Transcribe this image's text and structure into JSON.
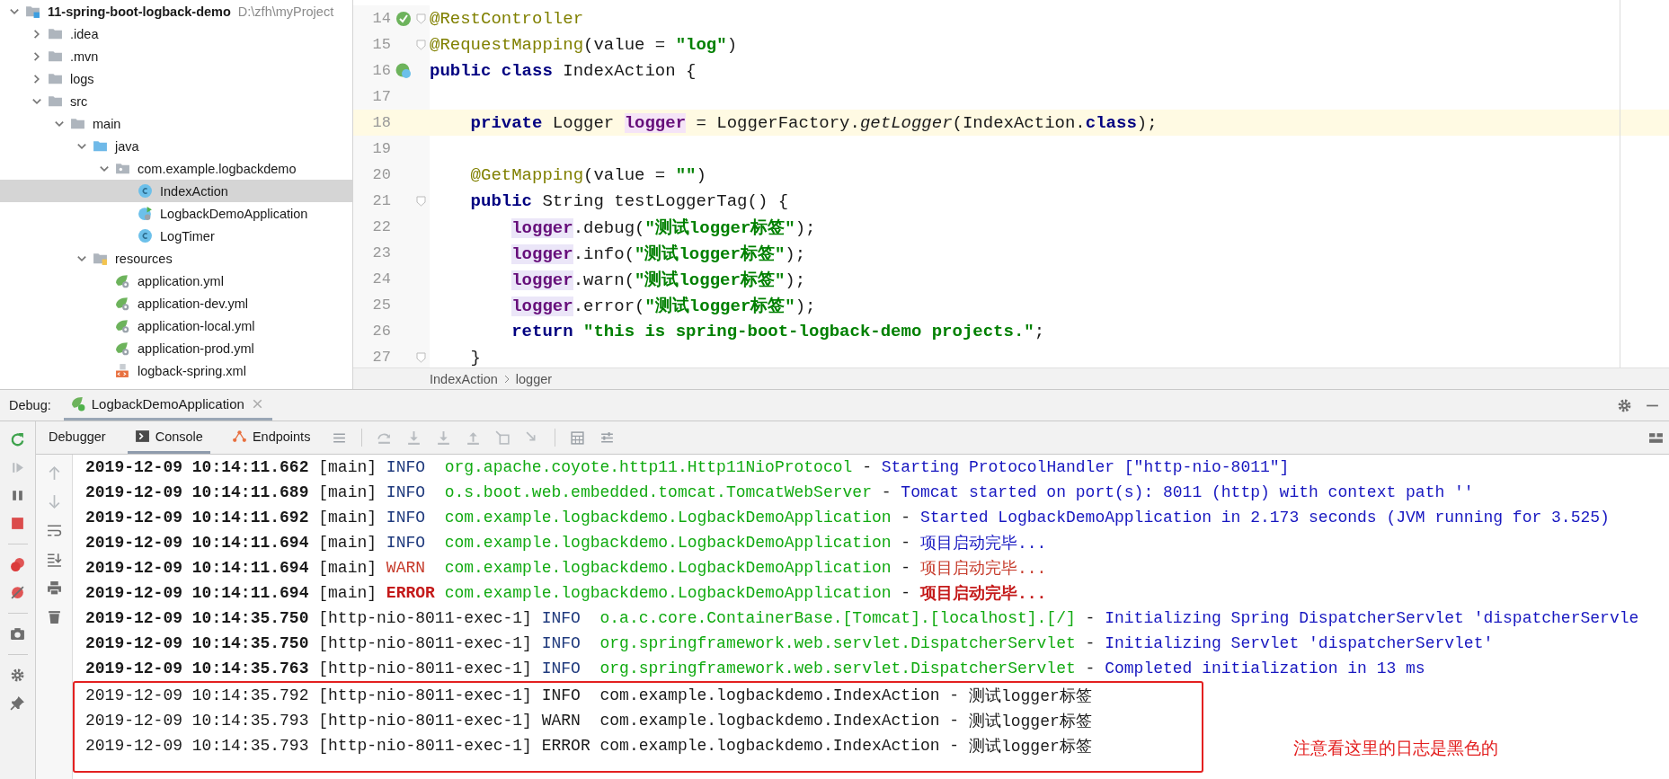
{
  "project_tree": [
    {
      "label": "11-spring-boot-logback-demo",
      "path": "D:\\zfh\\myProject",
      "kind": "module",
      "expanded": true,
      "selected": false,
      "children": [
        {
          "label": ".idea",
          "kind": "folder",
          "expanded": false,
          "selected": false
        },
        {
          "label": ".mvn",
          "kind": "folder",
          "expanded": false,
          "selected": false
        },
        {
          "label": "logs",
          "kind": "folder",
          "expanded": false,
          "selected": false
        },
        {
          "label": "src",
          "kind": "folder",
          "expanded": true,
          "selected": false,
          "children": [
            {
              "label": "main",
              "kind": "folder",
              "expanded": true,
              "selected": false,
              "children": [
                {
                  "label": "java",
                  "kind": "source-folder",
                  "expanded": true,
                  "selected": false,
                  "children": [
                    {
                      "label": "com.example.logbackdemo",
                      "kind": "package",
                      "expanded": true,
                      "selected": false,
                      "children": [
                        {
                          "label": "IndexAction",
                          "kind": "class",
                          "selected": true
                        },
                        {
                          "label": "LogbackDemoApplication",
                          "kind": "spring-class",
                          "selected": false
                        },
                        {
                          "label": "LogTimer",
                          "kind": "class",
                          "selected": false
                        }
                      ]
                    }
                  ]
                },
                {
                  "label": "resources",
                  "kind": "resources",
                  "expanded": true,
                  "selected": false,
                  "children": [
                    {
                      "label": "application.yml",
                      "kind": "spring-yml",
                      "selected": false
                    },
                    {
                      "label": "application-dev.yml",
                      "kind": "spring-yml",
                      "selected": false
                    },
                    {
                      "label": "application-local.yml",
                      "kind": "spring-yml",
                      "selected": false
                    },
                    {
                      "label": "application-prod.yml",
                      "kind": "spring-yml",
                      "selected": false
                    },
                    {
                      "label": "logback-spring.xml",
                      "kind": "xml",
                      "selected": false
                    }
                  ]
                }
              ]
            }
          ]
        }
      ]
    }
  ],
  "editor": {
    "lines": [
      {
        "number": "14",
        "kind": "bean",
        "fold": true,
        "current": false,
        "tokens": [
          {
            "text": "@RestController",
            "kind": "annotation"
          }
        ]
      },
      {
        "number": "15",
        "fold": true,
        "current": false,
        "tokens": [
          {
            "text": "@RequestMapping",
            "kind": "annotation"
          },
          {
            "text": "(value = ",
            "kind": "plain"
          },
          {
            "text": "\"log\"",
            "kind": "string"
          },
          {
            "text": ")",
            "kind": "plain"
          }
        ]
      },
      {
        "number": "16",
        "kind": "spring-class",
        "fold": false,
        "current": false,
        "tokens": [
          {
            "text": "public class ",
            "kind": "keyword"
          },
          {
            "text": "IndexAction {",
            "kind": "plain"
          }
        ]
      },
      {
        "number": "17",
        "fold": false,
        "current": false
      },
      {
        "number": "18",
        "fold": false,
        "current": true,
        "tokens": [
          {
            "text": "    private ",
            "kind": "keyword"
          },
          {
            "text": "Logger ",
            "kind": "plain"
          },
          {
            "text": "logger",
            "kind": "field-decl"
          },
          {
            "text": " = LoggerFactory.",
            "kind": "plain"
          },
          {
            "text": "getLogger",
            "kind": "static-call"
          },
          {
            "text": "(IndexAction.",
            "kind": "plain"
          },
          {
            "text": "class",
            "kind": "keyword"
          },
          {
            "text": ");",
            "kind": "plain"
          }
        ]
      },
      {
        "number": "19",
        "fold": false,
        "current": false
      },
      {
        "number": "20",
        "fold": false,
        "current": false,
        "tokens": [
          {
            "text": "    @GetMapping",
            "kind": "annotation"
          },
          {
            "text": "(value = ",
            "kind": "plain"
          },
          {
            "text": "\"\"",
            "kind": "string"
          },
          {
            "text": ")",
            "kind": "plain"
          }
        ]
      },
      {
        "number": "21",
        "fold": true,
        "current": false,
        "tokens": [
          {
            "text": "    public ",
            "kind": "keyword"
          },
          {
            "text": "String testLoggerTag() {",
            "kind": "plain"
          }
        ]
      },
      {
        "number": "22",
        "fold": false,
        "current": false,
        "tokens": [
          {
            "text": "        logger",
            "kind": "field"
          },
          {
            "text": ".debug(",
            "kind": "plain"
          },
          {
            "text": "\"测试logger标签\"",
            "kind": "string"
          },
          {
            "text": ");",
            "kind": "plain"
          }
        ]
      },
      {
        "number": "23",
        "fold": false,
        "current": false,
        "tokens": [
          {
            "text": "        logger",
            "kind": "field"
          },
          {
            "text": ".info(",
            "kind": "plain"
          },
          {
            "text": "\"测试logger标签\"",
            "kind": "string"
          },
          {
            "text": ");",
            "kind": "plain"
          }
        ]
      },
      {
        "number": "24",
        "fold": false,
        "current": false,
        "tokens": [
          {
            "text": "        logger",
            "kind": "field"
          },
          {
            "text": ".warn(",
            "kind": "plain"
          },
          {
            "text": "\"测试logger标签\"",
            "kind": "string"
          },
          {
            "text": ");",
            "kind": "plain"
          }
        ]
      },
      {
        "number": "25",
        "fold": false,
        "current": false,
        "tokens": [
          {
            "text": "        logger",
            "kind": "field"
          },
          {
            "text": ".error(",
            "kind": "plain"
          },
          {
            "text": "\"测试logger标签\"",
            "kind": "string"
          },
          {
            "text": ");",
            "kind": "plain"
          }
        ]
      },
      {
        "number": "26",
        "fold": false,
        "current": false,
        "tokens": [
          {
            "text": "        return ",
            "kind": "keyword"
          },
          {
            "text": "\"this is spring-boot-logback-demo projects.\"",
            "kind": "string"
          },
          {
            "text": ";",
            "kind": "plain"
          }
        ]
      },
      {
        "number": "27",
        "fold": true,
        "current": false,
        "tokens": [
          {
            "text": "    }",
            "kind": "plain"
          }
        ]
      }
    ],
    "breadcrumb": [
      "IndexAction",
      "logger"
    ]
  },
  "debug": {
    "label": "Debug:",
    "session_tab": "LogbackDemoApplication",
    "tabs": [
      {
        "label": "Debugger",
        "selected": false
      },
      {
        "label": "Console",
        "kind": "console",
        "selected": true
      },
      {
        "label": "Endpoints",
        "kind": "endpoints",
        "selected": false
      }
    ],
    "console": [
      {
        "timestamp": "2019-12-09 10:14:11.662",
        "thread": "[main]",
        "level": "INFO",
        "logger": "org.apache.coyote.http11.Http11NioProtocol",
        "sep": "-",
        "message": "Starting ProtocolHandler [\"http-nio-8011\"]",
        "kind": "info",
        "boxed": false
      },
      {
        "timestamp": "2019-12-09 10:14:11.689",
        "thread": "[main]",
        "level": "INFO",
        "logger": "o.s.boot.web.embedded.tomcat.TomcatWebServer",
        "sep": "-",
        "message": "Tomcat started on port(s): 8011 (http) with context path ''",
        "kind": "info",
        "boxed": false
      },
      {
        "timestamp": "2019-12-09 10:14:11.692",
        "thread": "[main]",
        "level": "INFO",
        "logger": "com.example.logbackdemo.LogbackDemoApplication",
        "sep": "-",
        "message": "Started LogbackDemoApplication in 2.173 seconds (JVM running for 3.525)",
        "kind": "info",
        "boxed": false
      },
      {
        "timestamp": "2019-12-09 10:14:11.694",
        "thread": "[main]",
        "level": "INFO",
        "logger": "com.example.logbackdemo.LogbackDemoApplication",
        "sep": "-",
        "message": "项目启动完毕...",
        "kind": "info",
        "boxed": false
      },
      {
        "timestamp": "2019-12-09 10:14:11.694",
        "thread": "[main]",
        "level": "WARN",
        "logger": "com.example.logbackdemo.LogbackDemoApplication",
        "sep": "-",
        "message": "项目启动完毕...",
        "kind": "warn",
        "boxed": false
      },
      {
        "timestamp": "2019-12-09 10:14:11.694",
        "thread": "[main]",
        "level": "ERROR",
        "logger": "com.example.logbackdemo.LogbackDemoApplication",
        "sep": "-",
        "message": "项目启动完毕...",
        "kind": "error",
        "boxed": false
      },
      {
        "timestamp": "2019-12-09 10:14:35.750",
        "thread": "[http-nio-8011-exec-1]",
        "level": "INFO",
        "logger": "o.a.c.core.ContainerBase.[Tomcat].[localhost].[/]",
        "sep": "-",
        "message": "Initializing Spring DispatcherServlet 'dispatcherServle",
        "kind": "info",
        "boxed": false
      },
      {
        "timestamp": "2019-12-09 10:14:35.750",
        "thread": "[http-nio-8011-exec-1]",
        "level": "INFO",
        "logger": "org.springframework.web.servlet.DispatcherServlet",
        "sep": "-",
        "message": "Initializing Servlet 'dispatcherServlet'",
        "kind": "info",
        "boxed": false
      },
      {
        "timestamp": "2019-12-09 10:14:35.763",
        "thread": "[http-nio-8011-exec-1]",
        "level": "INFO",
        "logger": "org.springframework.web.servlet.DispatcherServlet",
        "sep": "-",
        "message": "Completed initialization in 13 ms",
        "kind": "info",
        "boxed": false
      },
      {
        "timestamp": "2019-12-09 10:14:35.792",
        "thread": "[http-nio-8011-exec-1]",
        "level": "INFO",
        "logger": "com.example.logbackdemo.IndexAction",
        "sep": "-",
        "message": "测试logger标签",
        "kind": "plain",
        "boxed": true
      },
      {
        "timestamp": "2019-12-09 10:14:35.793",
        "thread": "[http-nio-8011-exec-1]",
        "level": "WARN",
        "logger": "com.example.logbackdemo.IndexAction",
        "sep": "-",
        "message": "测试logger标签",
        "kind": "plain",
        "boxed": true
      },
      {
        "timestamp": "2019-12-09 10:14:35.793",
        "thread": "[http-nio-8011-exec-1]",
        "level": "ERROR",
        "logger": "com.example.logbackdemo.IndexAction",
        "sep": "-",
        "message": "测试logger标签",
        "kind": "plain",
        "boxed": true
      }
    ],
    "annotation": "注意看这里的日志是黑色的"
  }
}
